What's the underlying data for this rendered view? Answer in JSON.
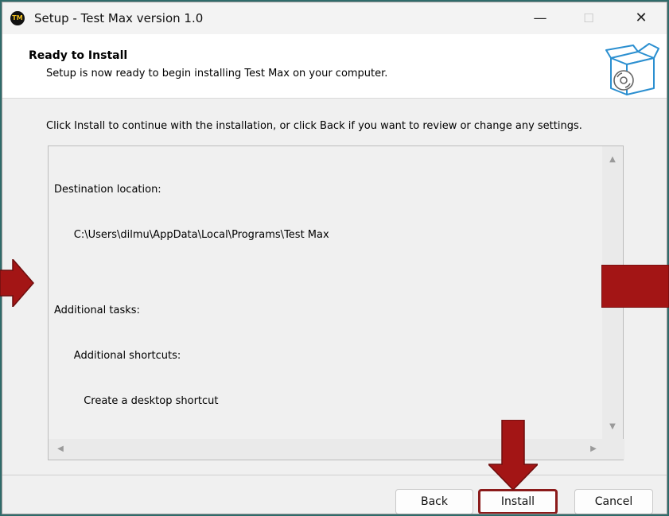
{
  "window": {
    "title": "Setup - Test Max version 1.0",
    "app_icon_text": "TM",
    "controls": {
      "minimize": "—",
      "maximize": "☐",
      "close": "✕"
    }
  },
  "header": {
    "title": "Ready to Install",
    "subtitle": "Setup is now ready to begin installing Test Max on your computer."
  },
  "main": {
    "instructions": "Click Install to continue with the installation, or click Back if you want to review or change any settings.",
    "memo_lines": [
      "Destination location:",
      "      C:\\Users\\dilmu\\AppData\\Local\\Programs\\Test Max",
      "",
      "Additional tasks:",
      "      Additional shortcuts:",
      "         Create a desktop shortcut"
    ]
  },
  "buttons": {
    "back": "Back",
    "install": "Install",
    "cancel": "Cancel"
  },
  "colors": {
    "annotation_arrow": "#a31515",
    "install_highlight": "#8b1a1a"
  }
}
